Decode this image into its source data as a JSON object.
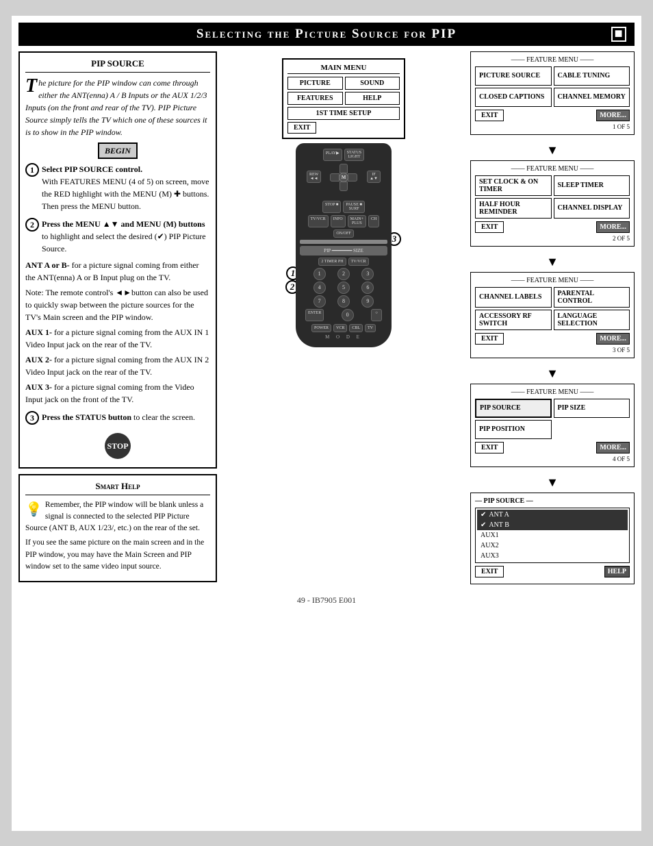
{
  "title": {
    "text": "Selecting the Picture Source for PIP",
    "corner_symbol": "■"
  },
  "pip_source": {
    "title": "PIP SOURCE",
    "intro": "The picture for the PIP window can come through either the ANT(enna) A / B Inputs or the AUX 1/2/3 Inputs (on the front and rear of the TV). PIP Picture Source simply tells the TV which one of these sources it is to show in the PIP window.",
    "begin_label": "BEGIN",
    "step1": {
      "number": "1",
      "heading": "Select PIP SOURCE control.",
      "body": "With FEATURES MENU (4 of 5) on screen, move the RED highlight with the MENU (M) ✚ buttons. Then press the MENU button."
    },
    "step2": {
      "number": "2",
      "heading": "Press the MENU ▲▼ and MENU (M) buttons to highlight and select the desired (✔) PIP Picture Source.",
      "body_ant": "ANT A or B- for a picture signal coming from either the ANT(enna) A or B Input plug on the TV.",
      "body_note": "Note: The remote control's ◄►button can also be used to quickly swap between the picture sources for the TV's Main screen and the PIP window.",
      "body_aux1": "AUX 1- for a picture signal coming from the AUX IN 1 Video Input jack on the rear of the TV.",
      "body_aux2": "AUX 2- for a picture signal coming from the AUX IN 2 Video Input jack on the rear of the TV.",
      "body_aux3": "AUX 3- for a picture signal coming from the Video Input jack on the front of the TV."
    },
    "step3": {
      "number": "3",
      "heading": "Press the STATUS button to clear the screen."
    },
    "stop_label": "STOP"
  },
  "smart_help": {
    "title": "Smart Help",
    "para1": "Remember, the PIP window will be blank unless a signal is connected to the selected PIP Picture Source (ANT B, AUX 1/23/, etc.) on the rear of the set.",
    "para2": "If you see the same picture on the main screen and in the PIP window, you may have the Main Screen and PIP window set to the same video input source."
  },
  "main_menu": {
    "title": "MAIN MENU",
    "items": [
      "PICTURE",
      "SOUND",
      "FEATURES",
      "HELP",
      "1ST TIME SETUP",
      "EXIT"
    ]
  },
  "feature_menus": [
    {
      "title": "FEATURE MENU",
      "items": [
        "PICTURE SOURCE",
        "CABLE TUNING",
        "CLOSED CAPTIONS",
        "CHANNEL MEMORY"
      ],
      "exit": "EXIT",
      "more": "MORE...",
      "page": "1 OF 5"
    },
    {
      "title": "FEATURE MENU",
      "items": [
        "SET CLOCK & ON TIMER",
        "SLEEP TIMER",
        "HALF HOUR REMINDER",
        "CHANNEL DISPLAY"
      ],
      "exit": "EXIT",
      "more": "MORE...",
      "page": "2 OF 5"
    },
    {
      "title": "FEATURE MENU",
      "items": [
        "CHANNEL LABELS",
        "PARENTAL CONTROL",
        "ACCESSORY RF SWITCH",
        "LANGUAGE SELECTION"
      ],
      "exit": "EXIT",
      "more": "MORE...",
      "page": "3 OF 5"
    },
    {
      "title": "FEATURE MENU",
      "items": [
        "PIP SOURCE",
        "PIP SIZE",
        "PIP POSITION"
      ],
      "exit": "EXIT",
      "more": "MORE...",
      "page": "4 OF 5"
    }
  ],
  "pip_source_final": {
    "title": "PIP SOURCE",
    "options": [
      "ANT A",
      "ANT B",
      "AUX1",
      "AUX2",
      "AUX3"
    ],
    "selected": [
      "ANT A",
      "ANT B"
    ],
    "exit": "EXIT",
    "help": "HELP"
  },
  "footer": "49 - IB7905 E001"
}
